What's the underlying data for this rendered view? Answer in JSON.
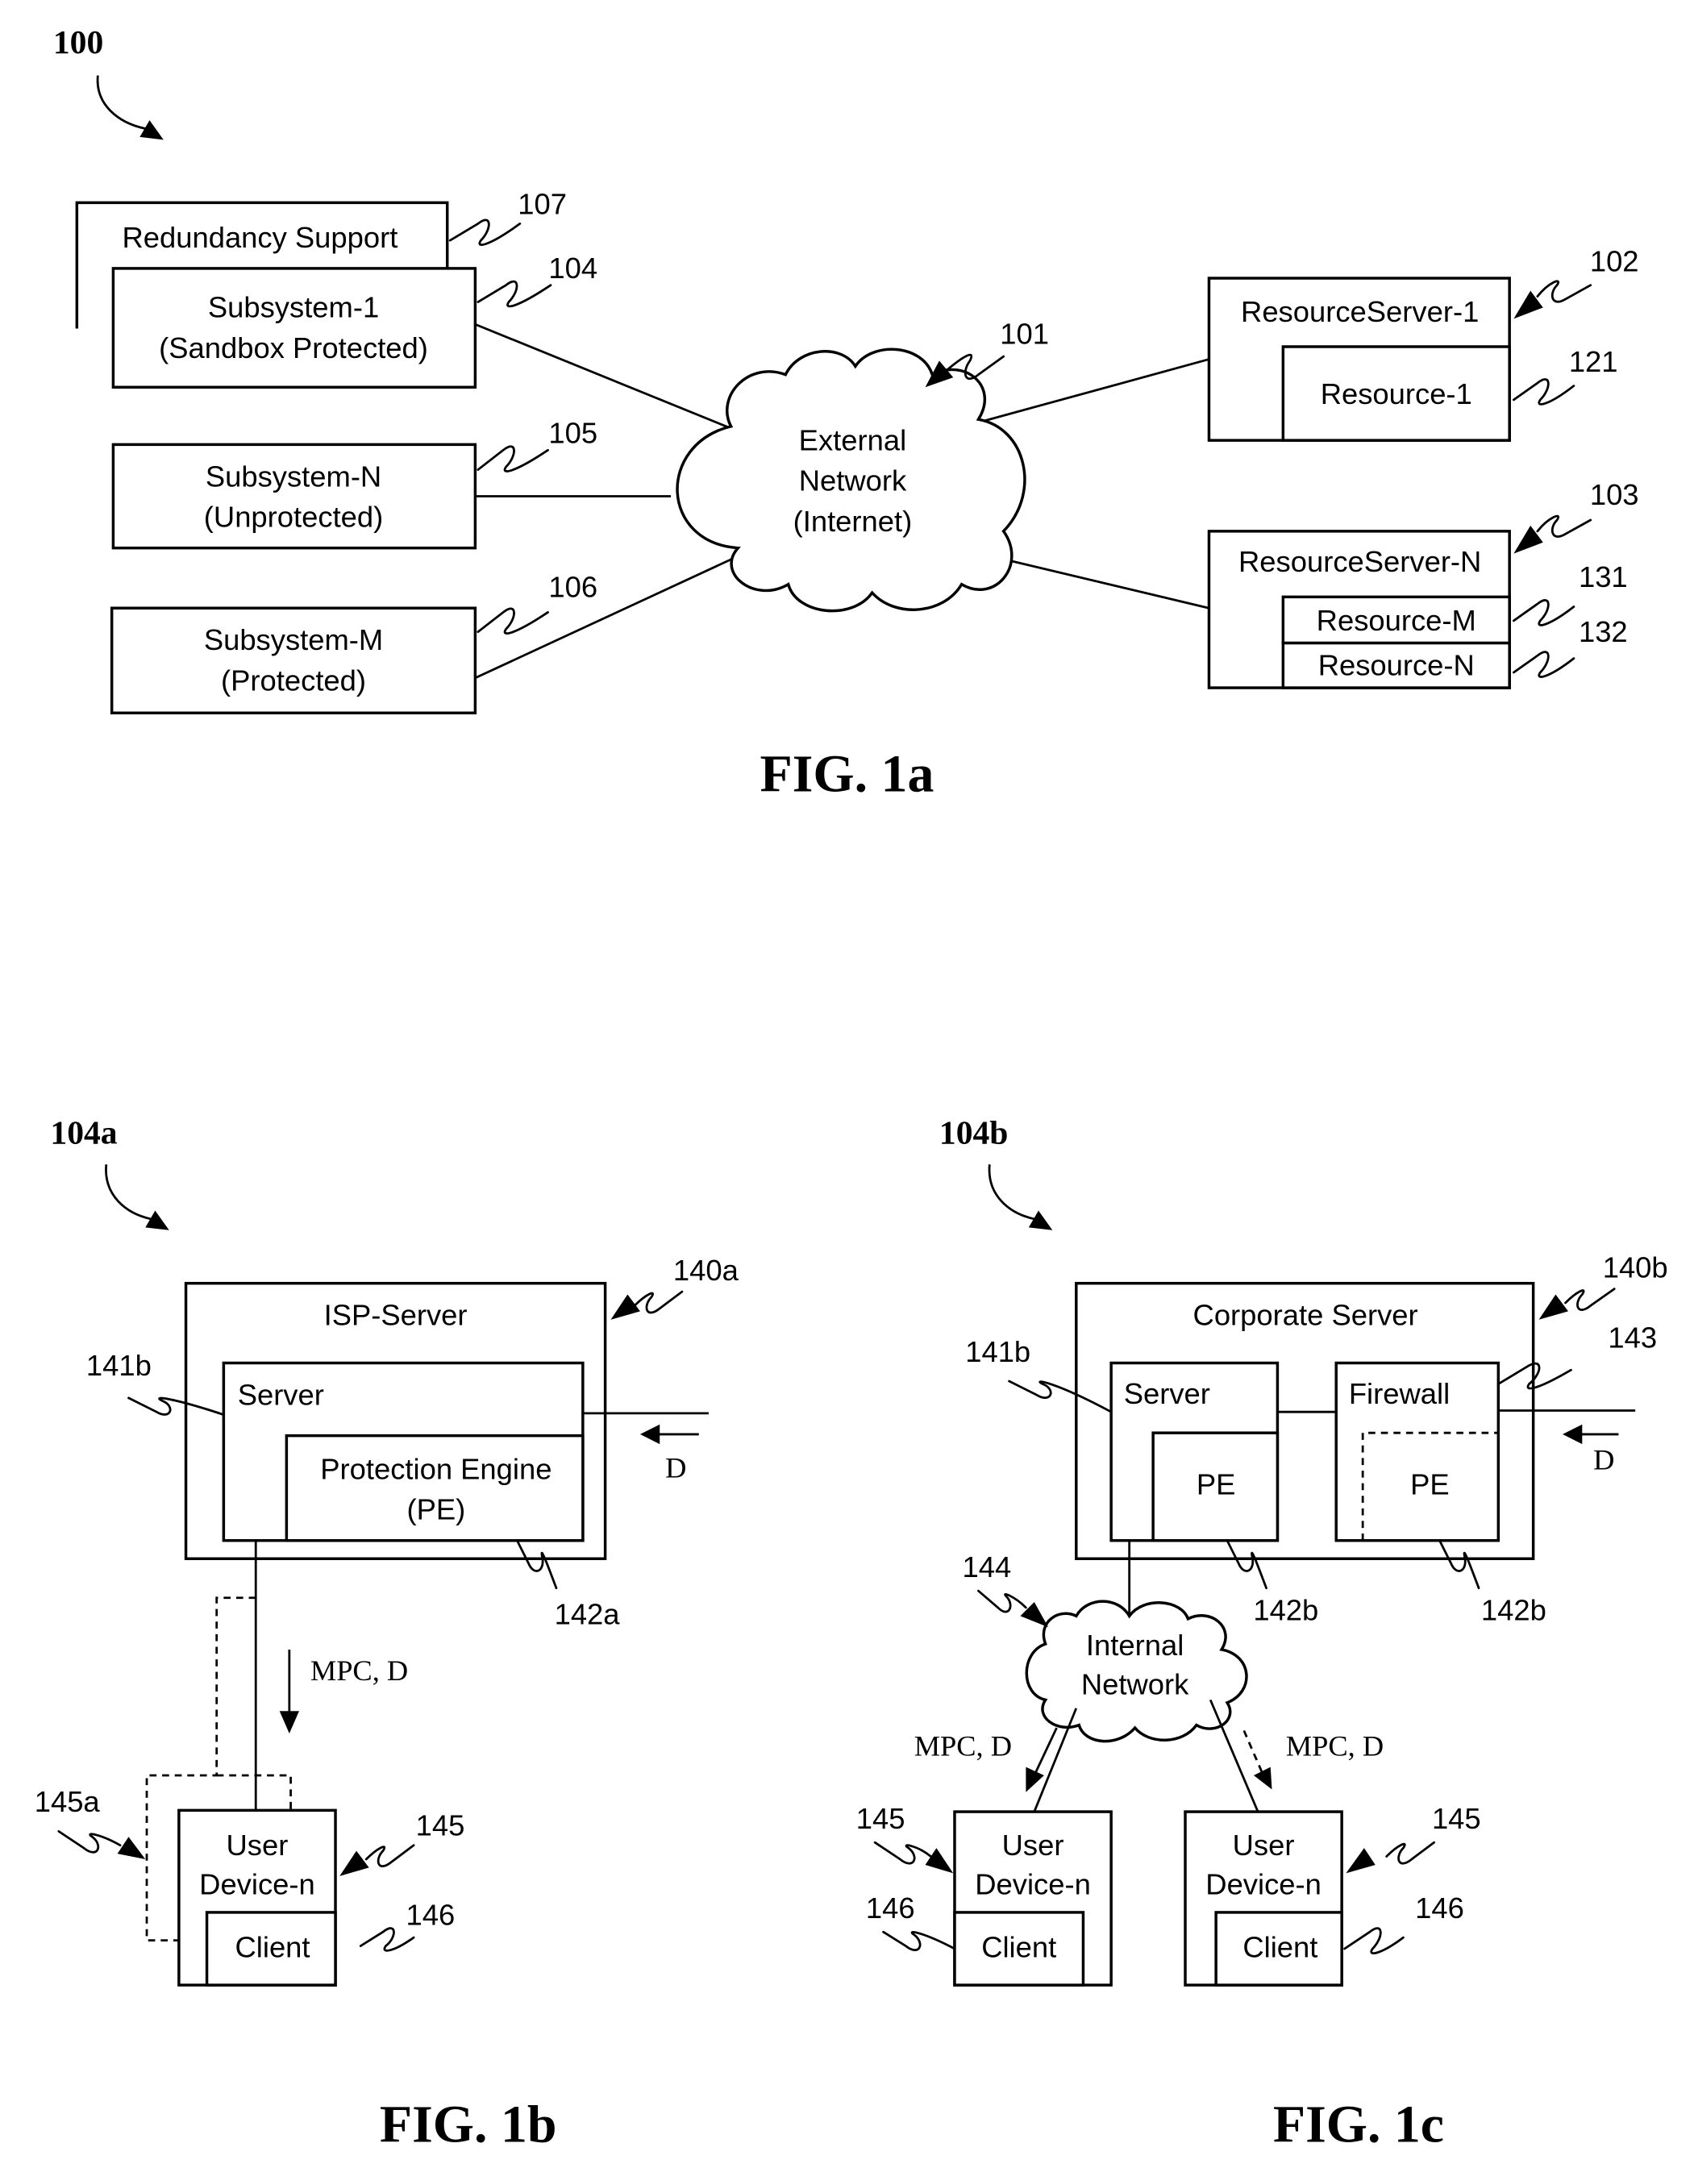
{
  "figure_1a": {
    "ref_number": "100",
    "caption": "FIG. 1a",
    "redundancy_support": {
      "label": "Redundancy Support",
      "ref": "107"
    },
    "subsystem_1": {
      "line1": "Subsystem-1",
      "line2": "(Sandbox Protected)",
      "ref": "104"
    },
    "subsystem_n": {
      "line1": "Subsystem-N",
      "line2": "(Unprotected)",
      "ref": "105"
    },
    "subsystem_m": {
      "line1": "Subsystem-M",
      "line2": "(Protected)",
      "ref": "106"
    },
    "external_network": {
      "line1": "External",
      "line2": "Network",
      "line3": "(Internet)",
      "ref": "101"
    },
    "resource_server_1": {
      "label": "ResourceServer-1",
      "ref": "102",
      "resource": {
        "label": "Resource-1",
        "ref": "121"
      }
    },
    "resource_server_n": {
      "label": "ResourceServer-N",
      "ref": "103",
      "resources": [
        {
          "label": "Resource-M",
          "ref": "131"
        },
        {
          "label": "Resource-N",
          "ref": "132"
        }
      ]
    }
  },
  "figure_1b": {
    "ref_number": "104a",
    "caption": "FIG. 1b",
    "isp_server": {
      "label": "ISP-Server",
      "ref": "140a"
    },
    "server": {
      "label": "Server",
      "ref": "141b"
    },
    "protection_engine": {
      "line1": "Protection Engine",
      "line2": "(PE)",
      "ref": "142a"
    },
    "incoming_data": "D",
    "flow_label": "MPC, D",
    "alt_device_ref": "145a",
    "user_device": {
      "line1": "User",
      "line2": "Device-n",
      "ref": "145"
    },
    "client": {
      "label": "Client",
      "ref": "146"
    }
  },
  "figure_1c": {
    "ref_number": "104b",
    "caption": "FIG. 1c",
    "corporate_server": {
      "label": "Corporate Server",
      "ref": "140b"
    },
    "server": {
      "label": "Server",
      "ref": "141b",
      "pe_label": "PE",
      "pe_ref": "142b"
    },
    "firewall": {
      "label": "Firewall",
      "ref": "143",
      "pe_label": "PE",
      "pe_ref": "142b"
    },
    "incoming_data": "D",
    "internal_network": {
      "line1": "Internal",
      "line2": "Network",
      "ref": "144"
    },
    "flow_label_left": "MPC, D",
    "flow_label_right": "MPC, D",
    "user_devices": [
      {
        "line1": "User",
        "line2": "Device-n",
        "ref": "145",
        "client_label": "Client",
        "client_ref": "146"
      },
      {
        "line1": "User",
        "line2": "Device-n",
        "ref": "145",
        "client_label": "Client",
        "client_ref": "146"
      }
    ]
  }
}
